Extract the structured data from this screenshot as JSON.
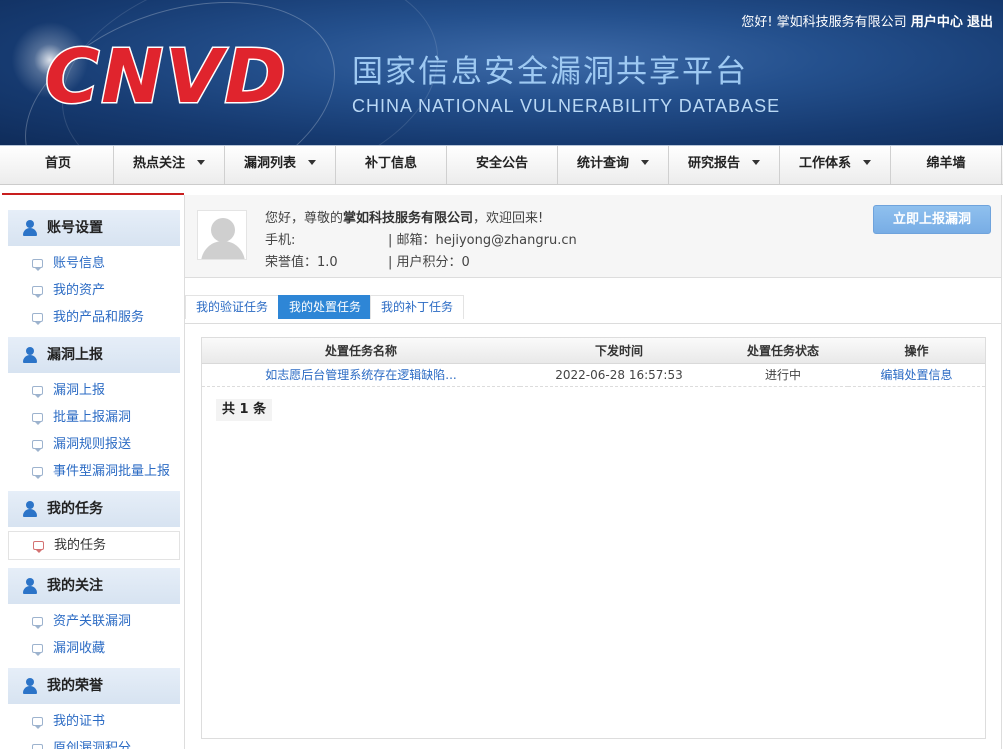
{
  "header": {
    "greeting": "您好!",
    "company": "掌如科技服务有限公司",
    "user_center": "用户中心",
    "logout": "退出",
    "logo_text": "CNVD",
    "cn_title": "国家信息安全漏洞共享平台",
    "en_title": "CHINA NATIONAL VULNERABILITY DATABASE",
    "logo_color": "#e0242d"
  },
  "nav": {
    "items": [
      {
        "label": "首页",
        "dropdown": false
      },
      {
        "label": "热点关注",
        "dropdown": true
      },
      {
        "label": "漏洞列表",
        "dropdown": true
      },
      {
        "label": "补丁信息",
        "dropdown": false
      },
      {
        "label": "安全公告",
        "dropdown": false
      },
      {
        "label": "统计查询",
        "dropdown": true
      },
      {
        "label": "研究报告",
        "dropdown": true
      },
      {
        "label": "工作体系",
        "dropdown": true
      },
      {
        "label": "绵羊墙",
        "dropdown": false
      }
    ]
  },
  "sidebar": {
    "sections": [
      {
        "title": "账号设置",
        "items": [
          "账号信息",
          "我的资产",
          "我的产品和服务"
        ]
      },
      {
        "title": "漏洞上报",
        "items": [
          "漏洞上报",
          "批量上报漏洞",
          "漏洞规则报送",
          "事件型漏洞批量上报"
        ]
      },
      {
        "title": "我的任务",
        "items": [
          "我的任务"
        ]
      },
      {
        "title": "我的关注",
        "items": [
          "资产关联漏洞",
          "漏洞收藏"
        ]
      },
      {
        "title": "我的荣誉",
        "items": [
          "我的证书",
          "原创漏洞积分"
        ]
      }
    ],
    "active_item": "我的任务"
  },
  "profile": {
    "welcome_prefix": "您好，尊敬的",
    "company": "掌如科技服务有限公司",
    "welcome_suffix": "，欢迎回来!",
    "phone_label": "手机:",
    "email_label": "| 邮箱：hejiyong@zhangru.cn",
    "honor_label": "荣誉值：1.0",
    "points_label": "| 用户积分：0",
    "report_button": "立即上报漏洞"
  },
  "tabs": [
    "我的验证任务",
    "我的处置任务",
    "我的补丁任务"
  ],
  "active_tab": "我的处置任务",
  "table": {
    "headers": [
      "处置任务名称",
      "下发时间",
      "处置任务状态",
      "操作"
    ],
    "rows": [
      {
        "name": "如志愿后台管理系统存在逻辑缺陷...",
        "time": "2022-06-28 16:57:53",
        "status": "进行中",
        "action": "编辑处置信息"
      }
    ]
  },
  "total": "共 1 条"
}
